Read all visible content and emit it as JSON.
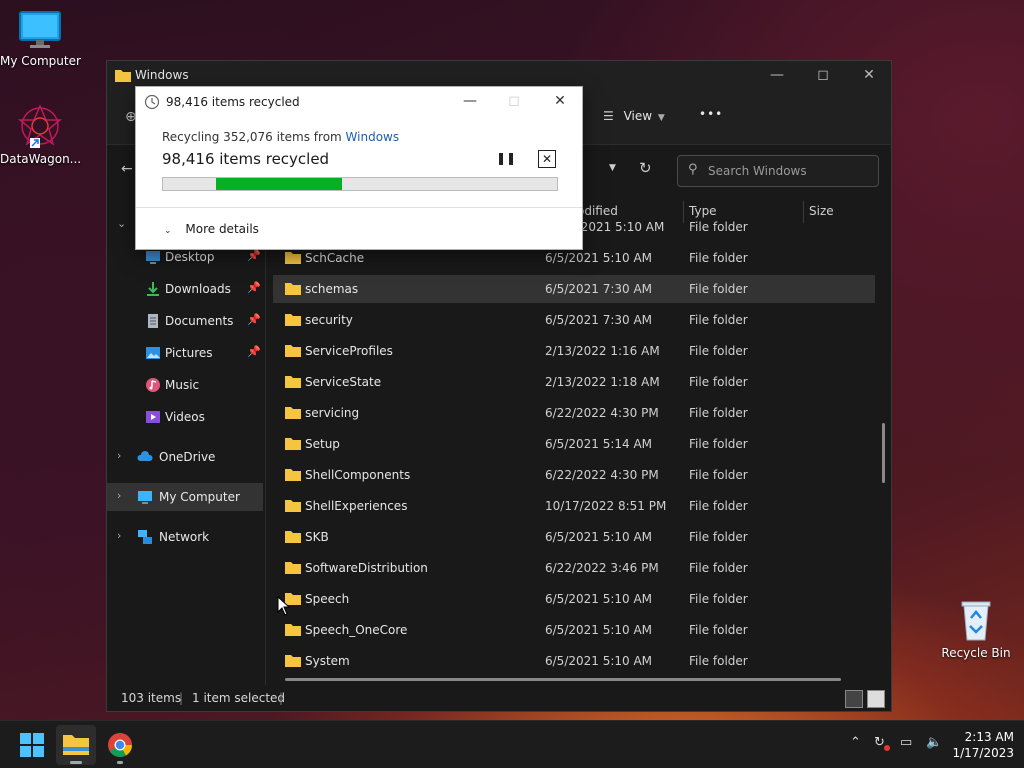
{
  "desktop": {
    "icons": [
      {
        "label": "My Computer"
      },
      {
        "label": "DataWagon..."
      },
      {
        "label": "Recycle Bin"
      }
    ]
  },
  "explorer": {
    "title": "Windows",
    "toolbar": {
      "view_label": "View",
      "more_label": "•••"
    },
    "search": {
      "placeholder": "Search Windows"
    },
    "columns": {
      "date": "odified",
      "type": "Type",
      "size": "Size"
    },
    "nav": [
      {
        "label": "Desktop"
      },
      {
        "label": "Downloads"
      },
      {
        "label": "Documents"
      },
      {
        "label": "Pictures"
      },
      {
        "label": "Music"
      },
      {
        "label": "Videos"
      },
      {
        "label": "OneDrive"
      },
      {
        "label": "My Computer"
      },
      {
        "label": "Network"
      }
    ],
    "rows": [
      {
        "name": "",
        "date": "5/2021 5:10 AM",
        "type": "File folder"
      },
      {
        "name": "SchCache",
        "date": "6/5/2021 5:10 AM",
        "type": "File folder"
      },
      {
        "name": "schemas",
        "date": "6/5/2021 7:30 AM",
        "type": "File folder"
      },
      {
        "name": "security",
        "date": "6/5/2021 7:30 AM",
        "type": "File folder"
      },
      {
        "name": "ServiceProfiles",
        "date": "2/13/2022 1:16 AM",
        "type": "File folder"
      },
      {
        "name": "ServiceState",
        "date": "2/13/2022 1:18 AM",
        "type": "File folder"
      },
      {
        "name": "servicing",
        "date": "6/22/2022 4:30 PM",
        "type": "File folder"
      },
      {
        "name": "Setup",
        "date": "6/5/2021 5:14 AM",
        "type": "File folder"
      },
      {
        "name": "ShellComponents",
        "date": "6/22/2022 4:30 PM",
        "type": "File folder"
      },
      {
        "name": "ShellExperiences",
        "date": "10/17/2022 8:51 PM",
        "type": "File folder"
      },
      {
        "name": "SKB",
        "date": "6/5/2021 5:10 AM",
        "type": "File folder"
      },
      {
        "name": "SoftwareDistribution",
        "date": "6/22/2022 3:46 PM",
        "type": "File folder"
      },
      {
        "name": "Speech",
        "date": "6/5/2021 5:10 AM",
        "type": "File folder"
      },
      {
        "name": "Speech_OneCore",
        "date": "6/5/2021 5:10 AM",
        "type": "File folder"
      },
      {
        "name": "System",
        "date": "6/5/2021 5:10 AM",
        "type": "File folder"
      }
    ],
    "status": {
      "items": "103 items",
      "selected": "1 item selected"
    }
  },
  "dialog": {
    "title": "98,416 items recycled",
    "line1_prefix": "Recycling 352,076 items from ",
    "line1_link": "Windows",
    "line2": "98,416 items recycled",
    "progress_start": 0.135,
    "progress_end": 0.455,
    "more_details": "More details"
  },
  "taskbar": {
    "time": "2:13 AM",
    "date": "1/17/2023"
  },
  "colors": {
    "accent": "#0078d4",
    "progress": "#06b025",
    "folder": "#f5c542"
  }
}
